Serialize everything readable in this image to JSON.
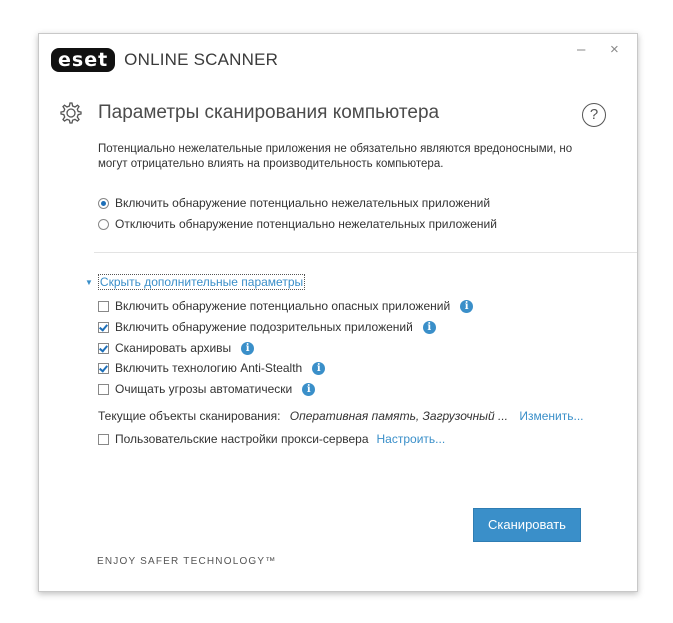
{
  "header": {
    "logo_text": "eset",
    "product_name": "ONLINE SCANNER",
    "minimize": "–",
    "close": "×"
  },
  "page": {
    "title": "Параметры сканирования компьютера",
    "help_label": "?",
    "description": "Потенциально нежелательные приложения не обязательно являются вредоносными, но могут отрицательно влиять на производительность компьютера."
  },
  "pua_options": [
    {
      "label": "Включить обнаружение потенциально нежелательных приложений",
      "selected": true
    },
    {
      "label": "Отключить обнаружение потенциально нежелательных приложений",
      "selected": false
    }
  ],
  "advanced": {
    "toggle_label": "Скрыть дополнительные параметры",
    "items": [
      {
        "label": "Включить обнаружение потенциально опасных приложений",
        "checked": false
      },
      {
        "label": "Включить обнаружение подозрительных приложений",
        "checked": true
      },
      {
        "label": "Сканировать архивы",
        "checked": true
      },
      {
        "label": "Включить технологию Anti-Stealth",
        "checked": true
      },
      {
        "label": "Очищать угрозы автоматически",
        "checked": false
      }
    ],
    "info_glyph": "i",
    "targets_label": "Текущие объекты сканирования:",
    "targets_value": "Оперативная память, Загрузочный ...",
    "targets_change": "Изменить...",
    "proxy_label": "Пользовательские настройки прокси-сервера",
    "proxy_checked": false,
    "proxy_link": "Настроить..."
  },
  "actions": {
    "scan_label": "Сканировать"
  },
  "footer": {
    "tagline": "ENJOY SAFER TECHNOLOGY™"
  },
  "colors": {
    "accent": "#3a8fc9",
    "logo_bg": "#111111"
  },
  "icons": {
    "settings": "gear-icon",
    "help": "help-icon",
    "info": "info-icon"
  }
}
